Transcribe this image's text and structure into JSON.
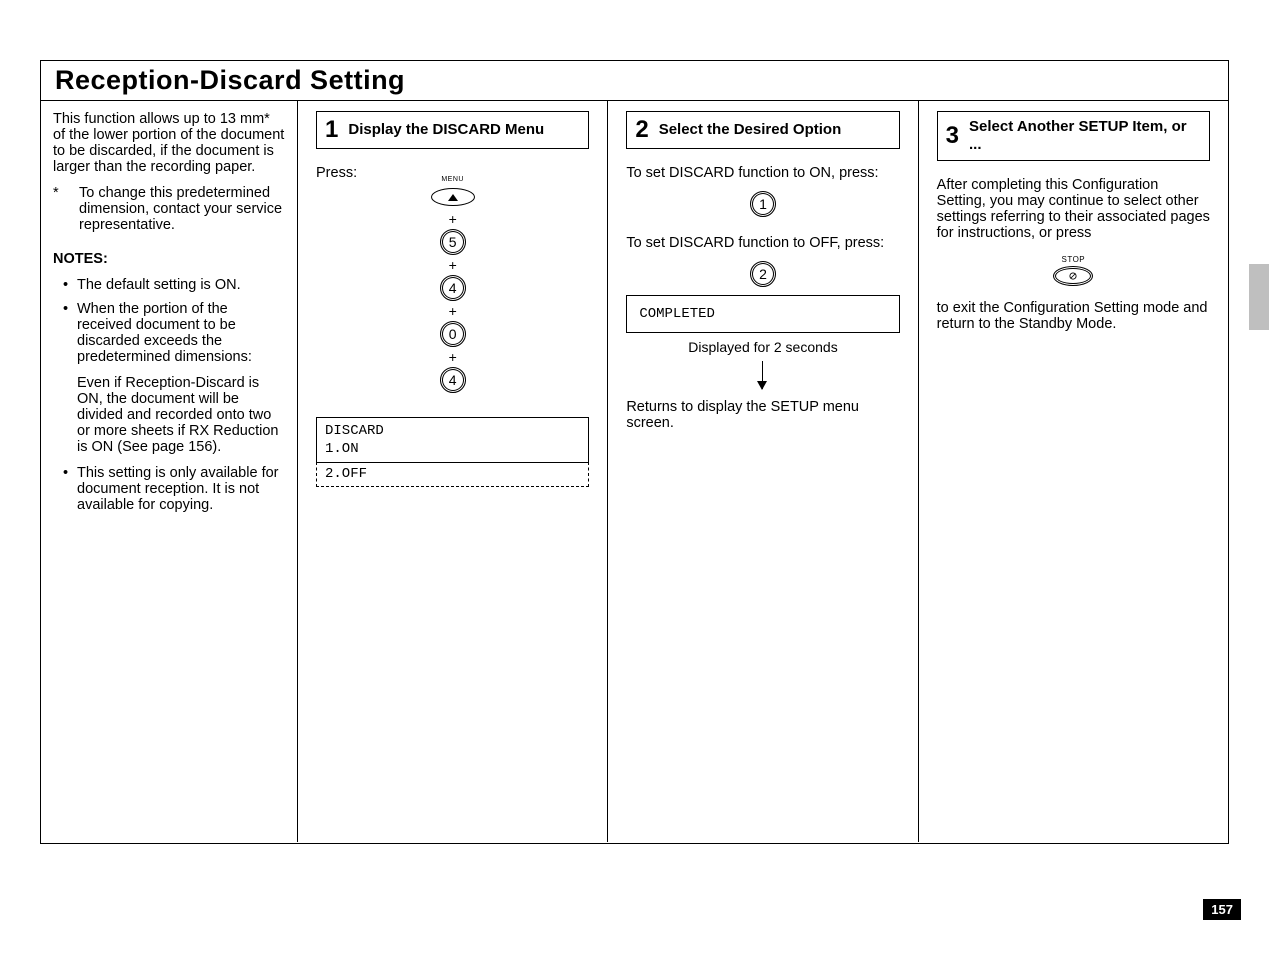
{
  "pageTitle": "Reception-Discard  Setting",
  "intro": {
    "p1": "This function allows up to 13 mm* of the lower portion of the document to be discarded, if the document is larger than the recording paper.",
    "starNote": "To change this predetermined dimension, contact your service representative.",
    "notesHeader": "NOTES:",
    "bullet1": "The default setting is ON.",
    "bullet2": "When the portion of the received document to be discarded exceeds the predetermined dimensions:",
    "bullet2sub": "Even if Reception-Discard is ON, the document will be divided and recorded onto two or more sheets if RX Reduction is ON (See page 156).",
    "bullet3": "This setting is only available for document reception. It is not available for copying."
  },
  "step1": {
    "num": "1",
    "title": "Display the DISCARD Menu",
    "press": "Press:",
    "menuLabel": "MENU",
    "keys": [
      "5",
      "4",
      "0",
      "4"
    ],
    "lcdLine1": "DISCARD",
    "lcdLine2": "1.ON",
    "lcdLine3": "2.OFF"
  },
  "step2": {
    "num": "2",
    "title": "Select the Desired Option",
    "onText": "To set DISCARD function to ON, press:",
    "offText": "To set DISCARD function to OFF, press:",
    "keyOn": "1",
    "keyOff": "2",
    "completed": "COMPLETED",
    "caption": "Displayed for 2 seconds",
    "returnText": "Returns to display the SETUP menu screen."
  },
  "step3": {
    "num": "3",
    "title": "Select Another SETUP Item, or ...",
    "after": "After completing this Configuration Setting, you may continue to select other settings referring to their associated pages for instructions, or press",
    "stopLabel": "STOP",
    "exitText": "to exit the Configuration Setting mode and return to the Standby Mode."
  },
  "pageNumber": "157"
}
